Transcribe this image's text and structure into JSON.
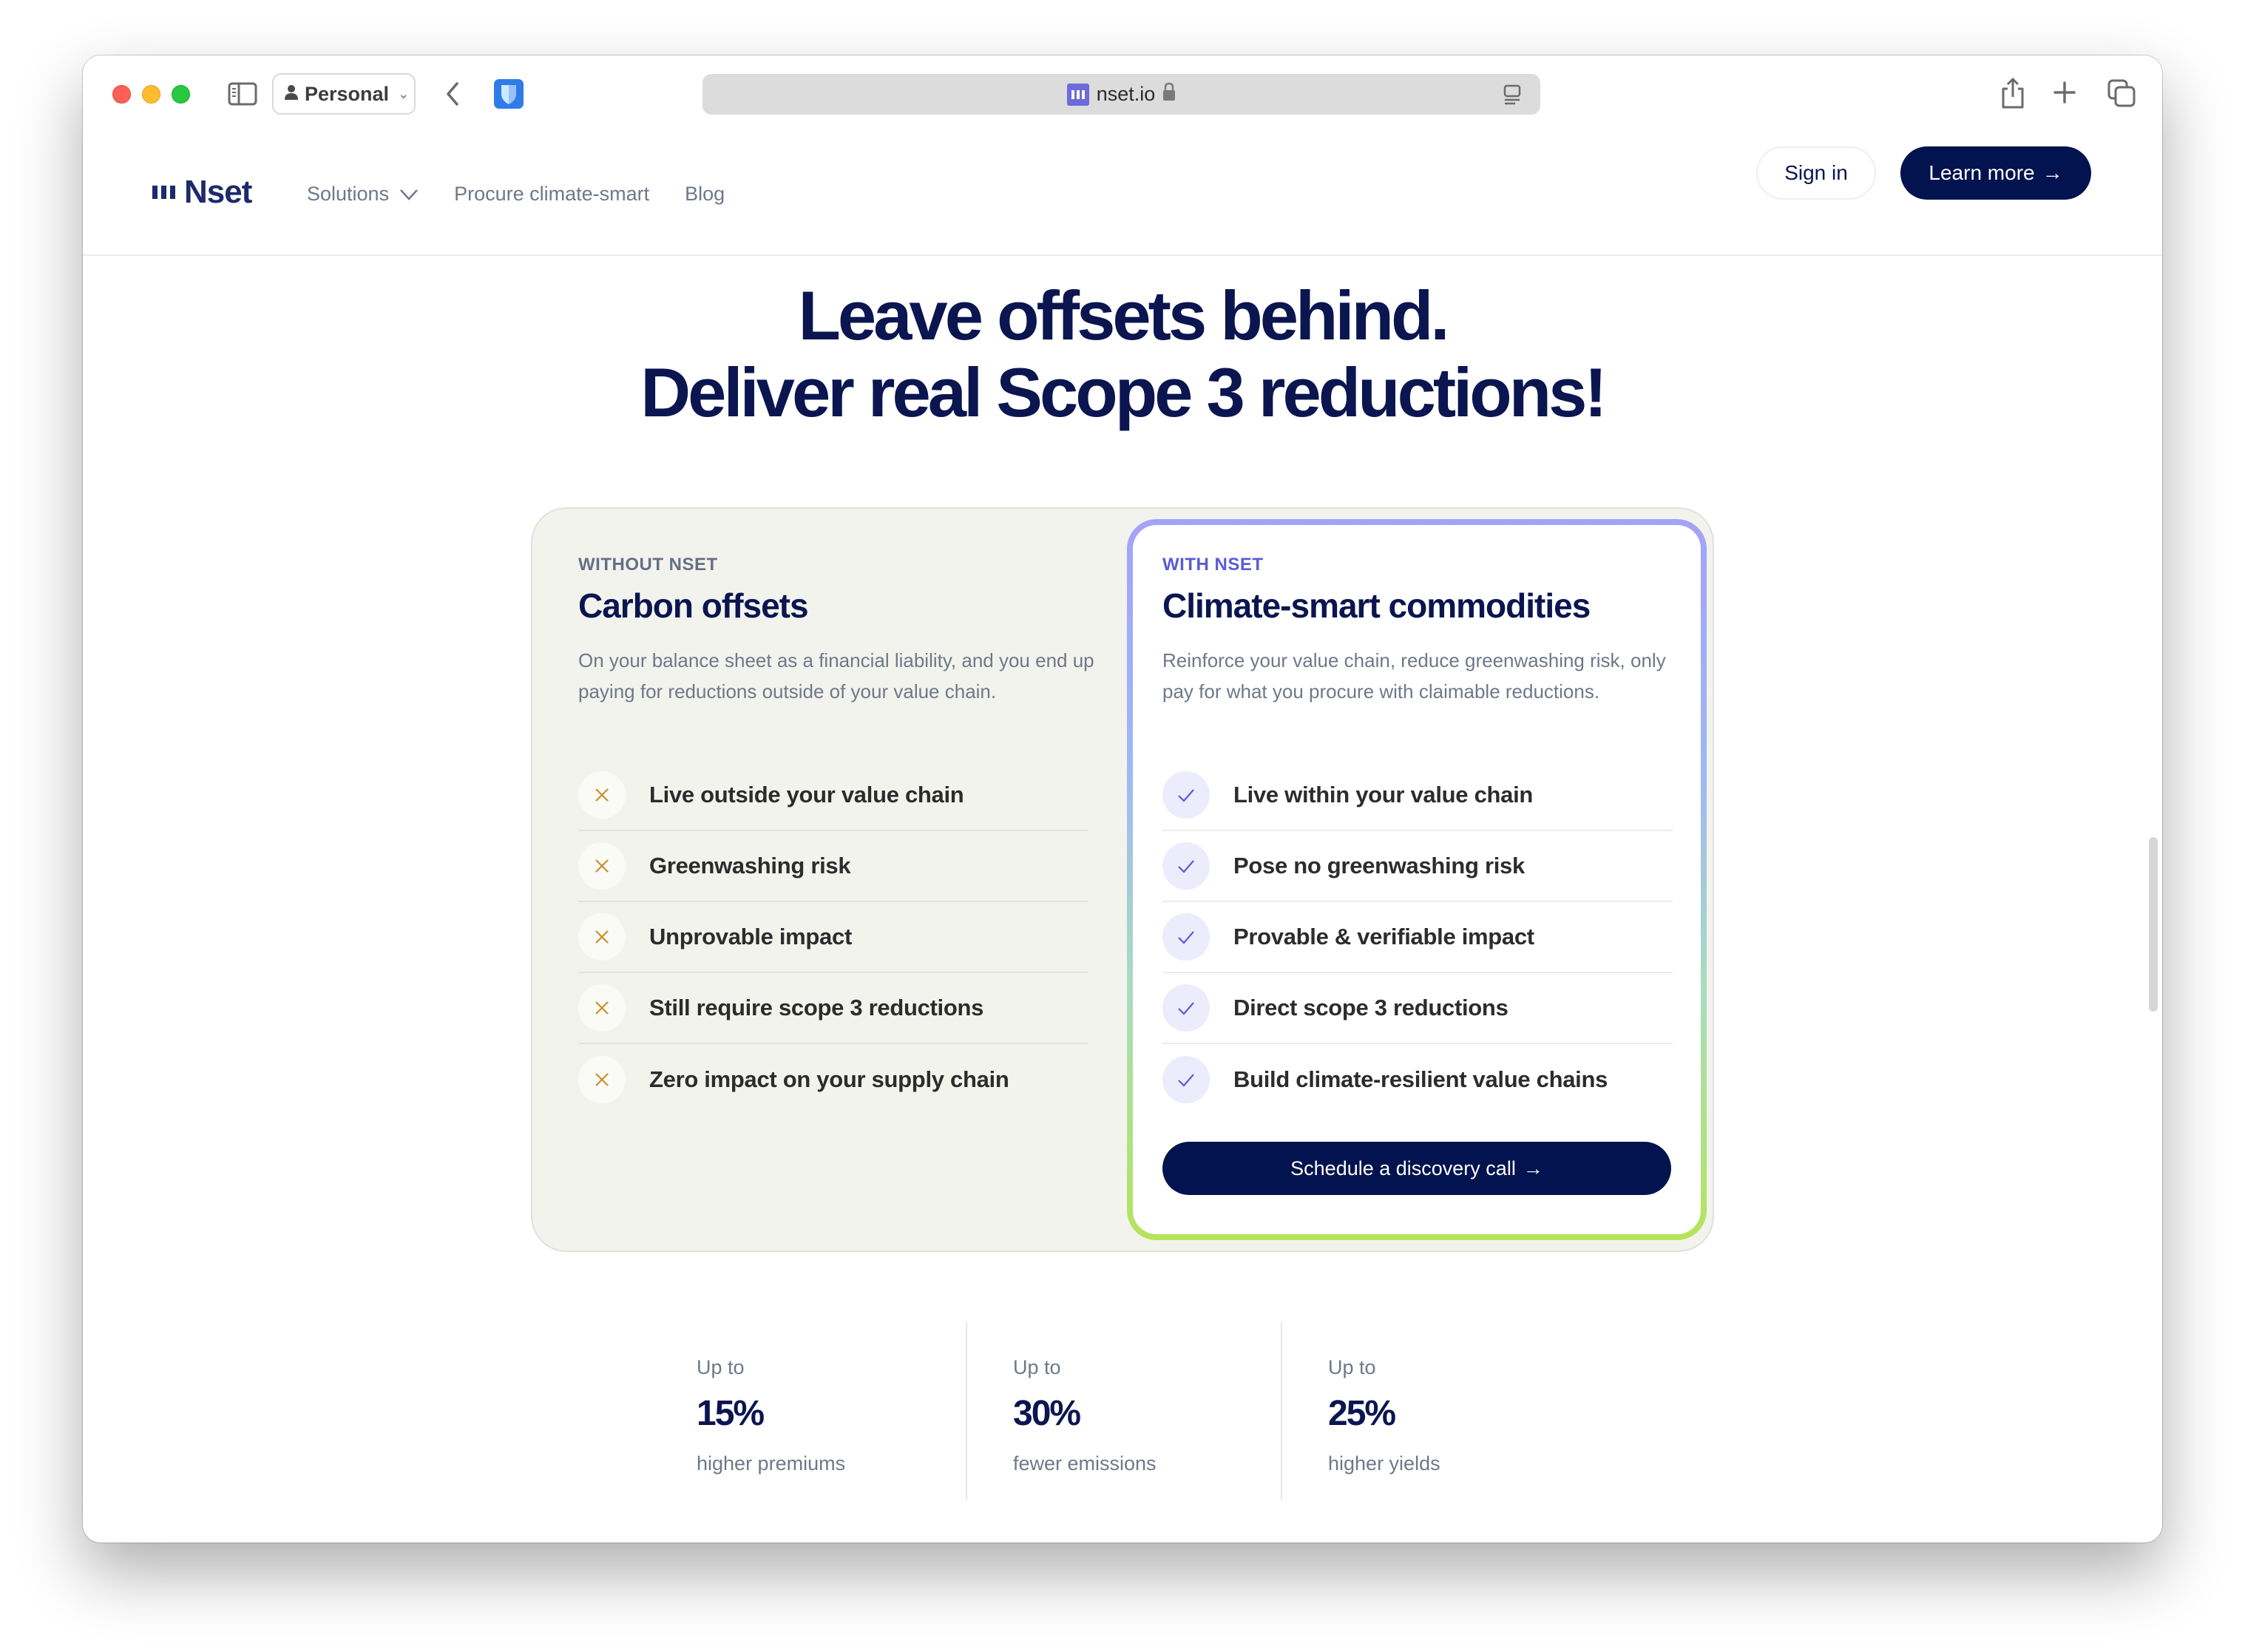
{
  "browser": {
    "profile_label": "Personal",
    "url": "nset.io",
    "icons": {
      "sidebar": "sidebar-toggle-icon",
      "profile": "person-icon",
      "back": "chevron-left-icon",
      "extension": "bitwarden-shield-icon",
      "favicon": "nset-favicon",
      "lock": "lock-icon",
      "reader": "reader-mode-icon",
      "share": "share-icon",
      "new_tab": "plus-icon",
      "tabs": "tab-overview-icon"
    }
  },
  "nav": {
    "logo": "Nset",
    "links": [
      {
        "label": "Solutions",
        "has_dropdown": true
      },
      {
        "label": "Procure climate-smart"
      },
      {
        "label": "Blog"
      }
    ],
    "signin_label": "Sign in",
    "learn_more_label": "Learn more",
    "arrow": "→"
  },
  "hero": {
    "line1": "Leave offsets behind.",
    "line2": "Deliver real Scope 3 reductions!"
  },
  "comparison": {
    "without": {
      "eyebrow": "WITHOUT NSET",
      "title": "Carbon offsets",
      "description": "On your balance sheet as a financial liability, and you end up paying for reductions outside of your value chain.",
      "icon": "x-icon",
      "items": [
        "Live outside your value chain",
        "Greenwashing risk",
        "Unprovable impact",
        "Still require scope 3 reductions",
        "Zero impact on your supply chain"
      ]
    },
    "with": {
      "eyebrow": "WITH NSET",
      "title": "Climate-smart commodities",
      "description": "Reinforce your value chain, reduce greenwashing risk, only pay for what you procure with claimable reductions.",
      "icon": "check-icon",
      "items": [
        "Live within your value chain",
        "Pose no greenwashing risk",
        "Provable & verifiable impact",
        "Direct scope 3 reductions",
        "Build climate-resilient value chains"
      ],
      "cta_label": "Schedule a discovery call",
      "cta_arrow": "→"
    }
  },
  "stats": [
    {
      "prefix": "Up to",
      "value": "15%",
      "caption": "higher premiums"
    },
    {
      "prefix": "Up to",
      "value": "30%",
      "caption": "fewer emissions"
    },
    {
      "prefix": "Up to",
      "value": "25%",
      "caption": "higher yields"
    }
  ],
  "colors": {
    "brand_navy": "#02134f",
    "accent_purple": "#5b5bd6",
    "x_icon": "#c8902a",
    "card_bg": "#f3f3ee"
  }
}
